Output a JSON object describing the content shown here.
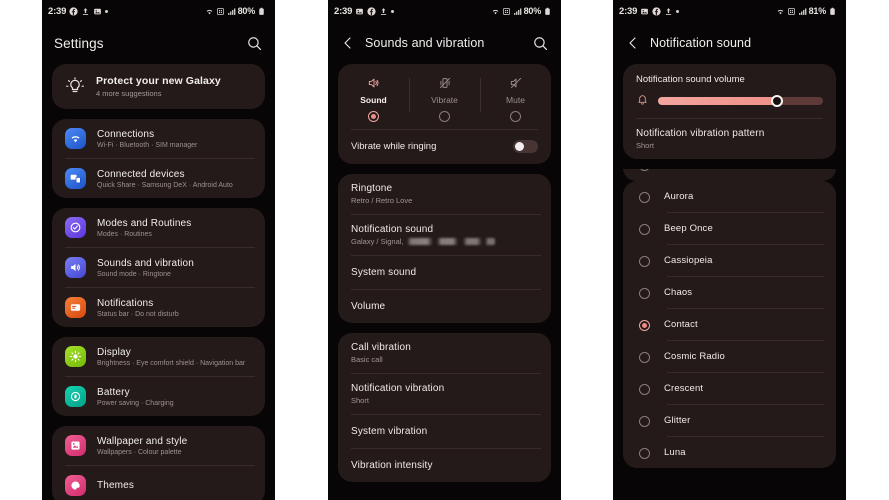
{
  "meta": {
    "bg": "#ffffff",
    "phone_bg": "#070505",
    "card_bg": "#231a19",
    "accent": "#ee8d84"
  },
  "phone1": {
    "status": {
      "time": "2:39",
      "battery": "80%",
      "icons": [
        "facebook-icon",
        "upload-icon",
        "image-icon",
        "dot-icon"
      ],
      "right_icons": [
        "wifi-icon",
        "sim-icon",
        "signal-icon"
      ]
    },
    "header": {
      "title": "Settings",
      "search_icon": "search-icon"
    },
    "suggestion": {
      "title": "Protect your new Galaxy",
      "subtitle": "4 more suggestions",
      "icon": "bulb-icon"
    },
    "groups": [
      {
        "items": [
          {
            "title": "Connections",
            "subtitle": "Wi-Fi  ·  Bluetooth  ·  SIM manager",
            "icon": "wifi-icon",
            "color": "#2e6bdd"
          },
          {
            "title": "Connected devices",
            "subtitle": "Quick Share  ·  Samsung DeX  ·  Android Auto",
            "icon": "devices-icon",
            "color": "#3069e0"
          }
        ]
      },
      {
        "items": [
          {
            "title": "Modes and Routines",
            "subtitle": "Modes  ·  Routines",
            "icon": "check-circle-icon",
            "color": "#6f55e8"
          },
          {
            "title": "Sounds and vibration",
            "subtitle": "Sound mode  ·  Ringtone",
            "icon": "speaker-icon",
            "color": "#5b5fe6"
          },
          {
            "title": "Notifications",
            "subtitle": "Status bar  ·  Do not disturb",
            "icon": "bell-box-icon",
            "color": "#e5631f"
          }
        ]
      },
      {
        "items": [
          {
            "title": "Display",
            "subtitle": "Brightness  ·  Eye comfort shield  ·  Navigation bar",
            "icon": "sun-icon",
            "color": "#8dcf19"
          },
          {
            "title": "Battery",
            "subtitle": "Power saving  ·  Charging",
            "icon": "battery-icon",
            "color": "#0dba9c"
          }
        ]
      },
      {
        "items": [
          {
            "title": "Wallpaper and style",
            "subtitle": "Wallpapers  ·  Colour palette",
            "icon": "wallpaper-icon",
            "color": "#e0487f"
          },
          {
            "title": "Themes",
            "subtitle": "",
            "icon": "themes-icon",
            "color": "#e0487f"
          }
        ]
      }
    ]
  },
  "phone2": {
    "status": {
      "time": "2:39",
      "battery": "80%"
    },
    "header": {
      "title": "Sounds and vibration",
      "back_icon": "back-chevron-icon",
      "search_icon": "search-icon"
    },
    "sound_modes": [
      {
        "label": "Sound",
        "icon": "speaker-on-icon",
        "selected": true
      },
      {
        "label": "Vibrate",
        "icon": "vibrate-icon",
        "selected": false
      },
      {
        "label": "Mute",
        "icon": "speaker-mute-icon",
        "selected": false
      }
    ],
    "vibrate_while_ringing": {
      "label": "Vibrate while ringing",
      "enabled": false
    },
    "group_sound": [
      {
        "title": "Ringtone",
        "subtitle": "Retro / Retro Love"
      },
      {
        "title": "Notification sound",
        "subtitle": "Galaxy / Signal,",
        "redacted": true
      },
      {
        "title": "System sound",
        "subtitle": ""
      },
      {
        "title": "Volume",
        "subtitle": ""
      }
    ],
    "group_vibration": [
      {
        "title": "Call vibration",
        "subtitle": "Basic call"
      },
      {
        "title": "Notification vibration",
        "subtitle": "Short"
      },
      {
        "title": "System vibration",
        "subtitle": ""
      },
      {
        "title": "Vibration intensity",
        "subtitle": ""
      }
    ]
  },
  "phone3": {
    "status": {
      "time": "2:39",
      "battery": "81%"
    },
    "header": {
      "title": "Notification sound",
      "back_icon": "back-chevron-icon"
    },
    "volume": {
      "label": "Notification sound volume",
      "icon": "bell-icon",
      "percent": 72
    },
    "vibration_pattern": {
      "title": "Notification vibration pattern",
      "subtitle": "Short"
    },
    "tones": [
      {
        "label": "Aurora",
        "selected": false
      },
      {
        "label": "Beep Once",
        "selected": false
      },
      {
        "label": "Cassiopeia",
        "selected": false
      },
      {
        "label": "Chaos",
        "selected": false
      },
      {
        "label": "Contact",
        "selected": true
      },
      {
        "label": "Cosmic Radio",
        "selected": false
      },
      {
        "label": "Crescent",
        "selected": false
      },
      {
        "label": "Glitter",
        "selected": false
      },
      {
        "label": "Luna",
        "selected": false
      }
    ]
  }
}
